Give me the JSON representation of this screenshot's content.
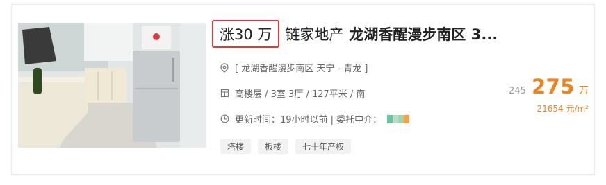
{
  "listing": {
    "badge": "涨30 万",
    "agency": "链家地产",
    "estate_title": "龙湖香醒漫步南区 3...",
    "location": "[ 龙湖香醒漫步南区 天宁 - 青龙 ]",
    "house_info": "高楼层 / 3室 3厅 / 127平米 / 南",
    "update_info": "更新时间：19小时以前 | 委托中介：",
    "tags": [
      "塔楼",
      "板楼",
      "七十年产权"
    ],
    "old_price": "245",
    "price": "275",
    "price_unit": "万",
    "unit_price": "21654 元/m²"
  },
  "icons": {
    "location": "location-pin-icon",
    "house": "building-icon",
    "clock": "clock-icon"
  },
  "colors": {
    "accent": "#f0821e",
    "badge_border": "#e03a3a",
    "mosaic": [
      "#6cc3a0",
      "#b8ddc3",
      "#f5a24a"
    ]
  }
}
